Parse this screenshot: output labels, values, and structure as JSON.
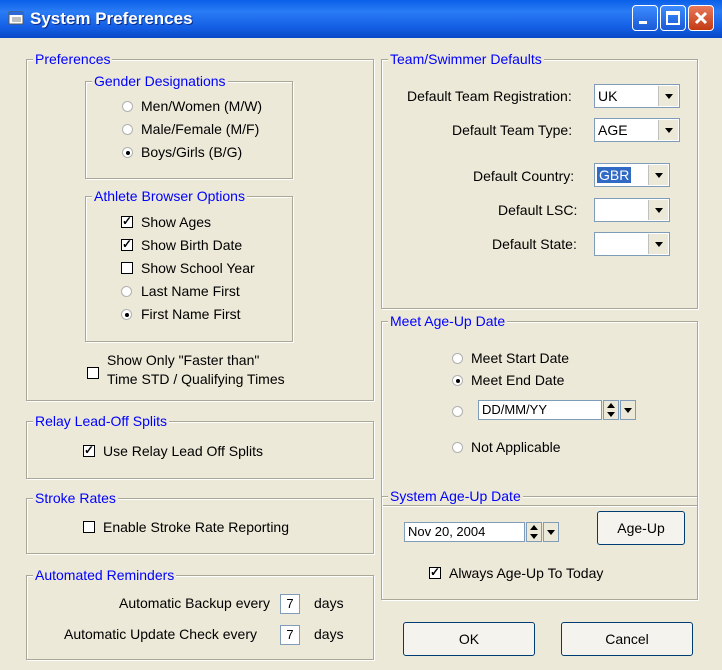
{
  "window": {
    "title": "System Preferences"
  },
  "preferences": {
    "legend": "Preferences",
    "gender": {
      "legend": "Gender Designations",
      "options": [
        "Men/Women (M/W)",
        "Male/Female (M/F)",
        "Boys/Girls (B/G)"
      ],
      "selected": 2
    },
    "athlete_browser": {
      "legend": "Athlete Browser Options",
      "show_ages": "Show Ages",
      "show_birth_date": "Show Birth Date",
      "show_school_year": "Show School Year",
      "last_name_first": "Last Name First",
      "first_name_first": "First Name First",
      "checked": [
        "Show Ages",
        "Show Birth Date"
      ],
      "name_order_selected": "First Name First"
    },
    "faster_than_line1": "Show Only  \"Faster than\"",
    "faster_than_line2": "Time STD / Qualifying Times"
  },
  "relay": {
    "legend": "Relay Lead-Off Splits",
    "use_label": "Use Relay Lead Off Splits",
    "checked": true
  },
  "stroke": {
    "legend": "Stroke Rates",
    "enable_label": "Enable Stroke Rate Reporting",
    "checked": false
  },
  "reminders": {
    "legend": "Automated Reminders",
    "backup_label": "Automatic Backup every",
    "backup_value": "7",
    "update_label": "Automatic Update Check every",
    "update_value": "7",
    "days": "days"
  },
  "team_defaults": {
    "legend": "Team/Swimmer Defaults",
    "registration_label": "Default Team Registration:",
    "registration_value": "UK",
    "type_label": "Default Team Type:",
    "type_value": "AGE",
    "country_label": "Default Country:",
    "country_value": "GBR",
    "lsc_label": "Default LSC:",
    "lsc_value": "",
    "state_label": "Default State:",
    "state_value": ""
  },
  "meet_ageup": {
    "legend": "Meet Age-Up Date",
    "start": "Meet Start Date",
    "end": "Meet End Date",
    "custom_value": "DD/MM/YY",
    "na": "Not Applicable",
    "selected": "Meet End Date"
  },
  "system_ageup": {
    "legend": "System Age-Up Date",
    "date_value": "Nov 20, 2004",
    "ageup_button": "Age-Up",
    "always_label": "Always Age-Up To Today",
    "always_checked": true
  },
  "buttons": {
    "ok": "OK",
    "cancel": "Cancel"
  }
}
